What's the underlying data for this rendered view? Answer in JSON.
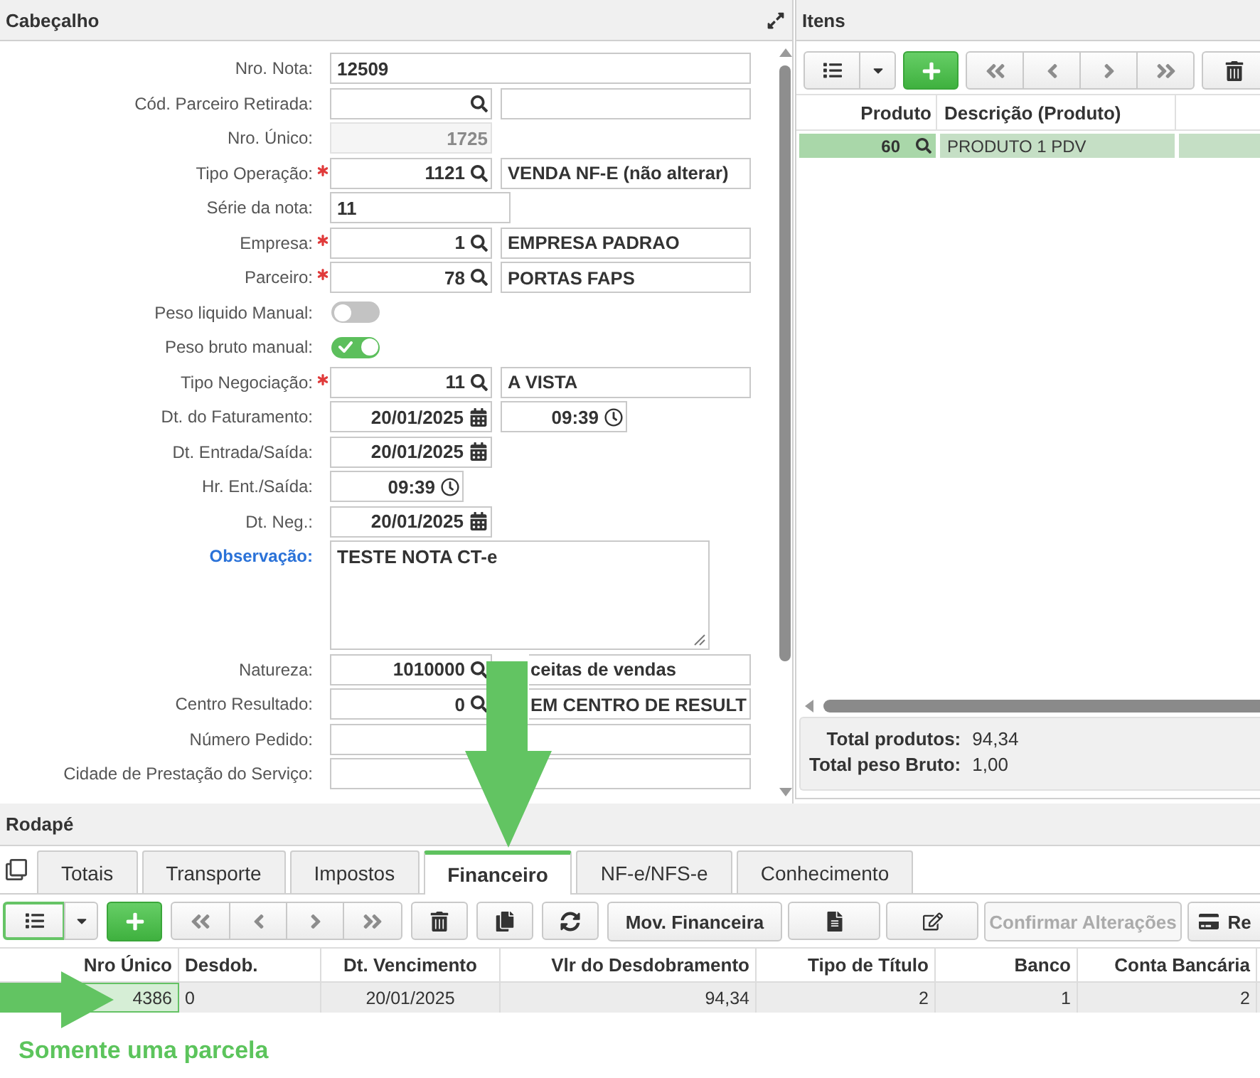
{
  "cabecalho": {
    "title": "Cabeçalho",
    "fields": [
      {
        "label": "Nro. Nota:",
        "kind": "text",
        "required": false,
        "value": "12509"
      },
      {
        "label": "Cód. Parceiro Retirada:",
        "kind": "lookup",
        "required": false
      },
      {
        "label": "Nro. Único:",
        "kind": "readonly",
        "required": false,
        "value": "1725"
      },
      {
        "label": "Tipo Operação:",
        "kind": "lookup",
        "required": true,
        "code": "1121",
        "description": "VENDA NF-E (não alterar)",
        "overlapped": false
      },
      {
        "label": "Série da nota:",
        "kind": "short",
        "required": false,
        "value": "11"
      },
      {
        "label": "Empresa:",
        "kind": "lookup",
        "required": true,
        "code": "1",
        "description": "EMPRESA PADRAO",
        "overlapped": false
      },
      {
        "label": "Parceiro:",
        "kind": "lookup",
        "required": true,
        "code": "78",
        "description": "PORTAS FAPS",
        "overlapped": false
      },
      {
        "label": "Peso liquido Manual:",
        "kind": "toggle",
        "required": false,
        "on": false
      },
      {
        "label": "Peso bruto manual:",
        "kind": "toggle",
        "required": false,
        "on": true
      },
      {
        "label": "Tipo Negociação:",
        "kind": "lookup",
        "required": true,
        "code": "11",
        "description": "A VISTA",
        "overlapped": false
      },
      {
        "label": "Dt. do Faturamento:",
        "kind": "datetime",
        "required": false,
        "date": "20/01/2025",
        "time": "09:39"
      },
      {
        "label": "Dt. Entrada/Saída:",
        "kind": "date",
        "required": false,
        "date": "20/01/2025"
      },
      {
        "label": "Hr. Ent./Saída:",
        "kind": "time",
        "required": false,
        "time": "09:39"
      },
      {
        "label": "Dt. Neg.:",
        "kind": "date",
        "required": false,
        "date": "20/01/2025"
      },
      {
        "label": "Observação:",
        "kind": "textarea",
        "required": false,
        "value": "TESTE NOTA CT-e"
      },
      {
        "label": "Natureza:",
        "kind": "lookup",
        "required": false,
        "code": "1010000",
        "description": "ceitas de vendas",
        "overlapped": true
      },
      {
        "label": "Centro Resultado:",
        "kind": "lookup",
        "required": false,
        "code": "0",
        "description": "EM CENTRO DE RESULT",
        "overlapped": true
      },
      {
        "label": "Número Pedido:",
        "kind": "text",
        "required": false
      },
      {
        "label": "Cidade de Prestação do Serviço:",
        "kind": "text",
        "required": false
      }
    ]
  },
  "itens": {
    "title": "Itens",
    "toolbar": {
      "view_focused": false
    },
    "columns": [
      "Produto",
      "Descrição (Produto)"
    ],
    "rows": [
      {
        "selected": true,
        "cells": [
          "60",
          "PRODUTO 1 PDV"
        ]
      }
    ],
    "totals": [
      {
        "label": "Total produtos:",
        "value": "94,34"
      },
      {
        "label": "Total peso Bruto:",
        "value": "1,00"
      }
    ]
  },
  "rodape": {
    "title": "Rodapé",
    "tabs": [
      {
        "label": "Totais",
        "selected": false
      },
      {
        "label": "Transporte",
        "selected": false
      },
      {
        "label": "Impostos",
        "selected": false
      },
      {
        "label": "Financeiro",
        "selected": true
      },
      {
        "label": "NF-e/NFS-e",
        "selected": false
      },
      {
        "label": "Conhecimento",
        "selected": false
      }
    ],
    "toolbar": {
      "view_focused": true,
      "buttons": [
        {
          "label": "Mov. Financeira",
          "kind": "text",
          "disabled": false
        },
        {
          "label": "Confirmar Alterações",
          "kind": "text",
          "disabled": true
        },
        {
          "label": "Re",
          "kind": "icon-text",
          "disabled": false
        }
      ]
    },
    "table": {
      "columns": [
        {
          "label": "Nro Único",
          "kind": "number"
        },
        {
          "label": "Desdob.",
          "kind": "text"
        },
        {
          "label": "Dt. Vencimento",
          "kind": "date"
        },
        {
          "label": "Vlr do Desdobramento",
          "kind": "number"
        },
        {
          "label": "Tipo de Título",
          "kind": "number"
        },
        {
          "label": "Banco",
          "kind": "number"
        },
        {
          "label": "Conta Bancária",
          "kind": "number"
        }
      ],
      "rows": [
        {
          "selected": true,
          "cells": [
            {
              "value": "4386",
              "focused": true
            },
            {
              "value": "0",
              "focused": false
            },
            {
              "value": "20/01/2025",
              "focused": false
            },
            {
              "value": "94,34",
              "focused": false
            },
            {
              "value": "2",
              "focused": false
            },
            {
              "value": "1",
              "focused": false
            },
            {
              "value": "2",
              "focused": false
            }
          ]
        }
      ]
    }
  },
  "annotations": {
    "arrows": [
      {
        "kind": "down"
      },
      {
        "kind": "right"
      }
    ],
    "note": "Somente uma parcela"
  }
}
